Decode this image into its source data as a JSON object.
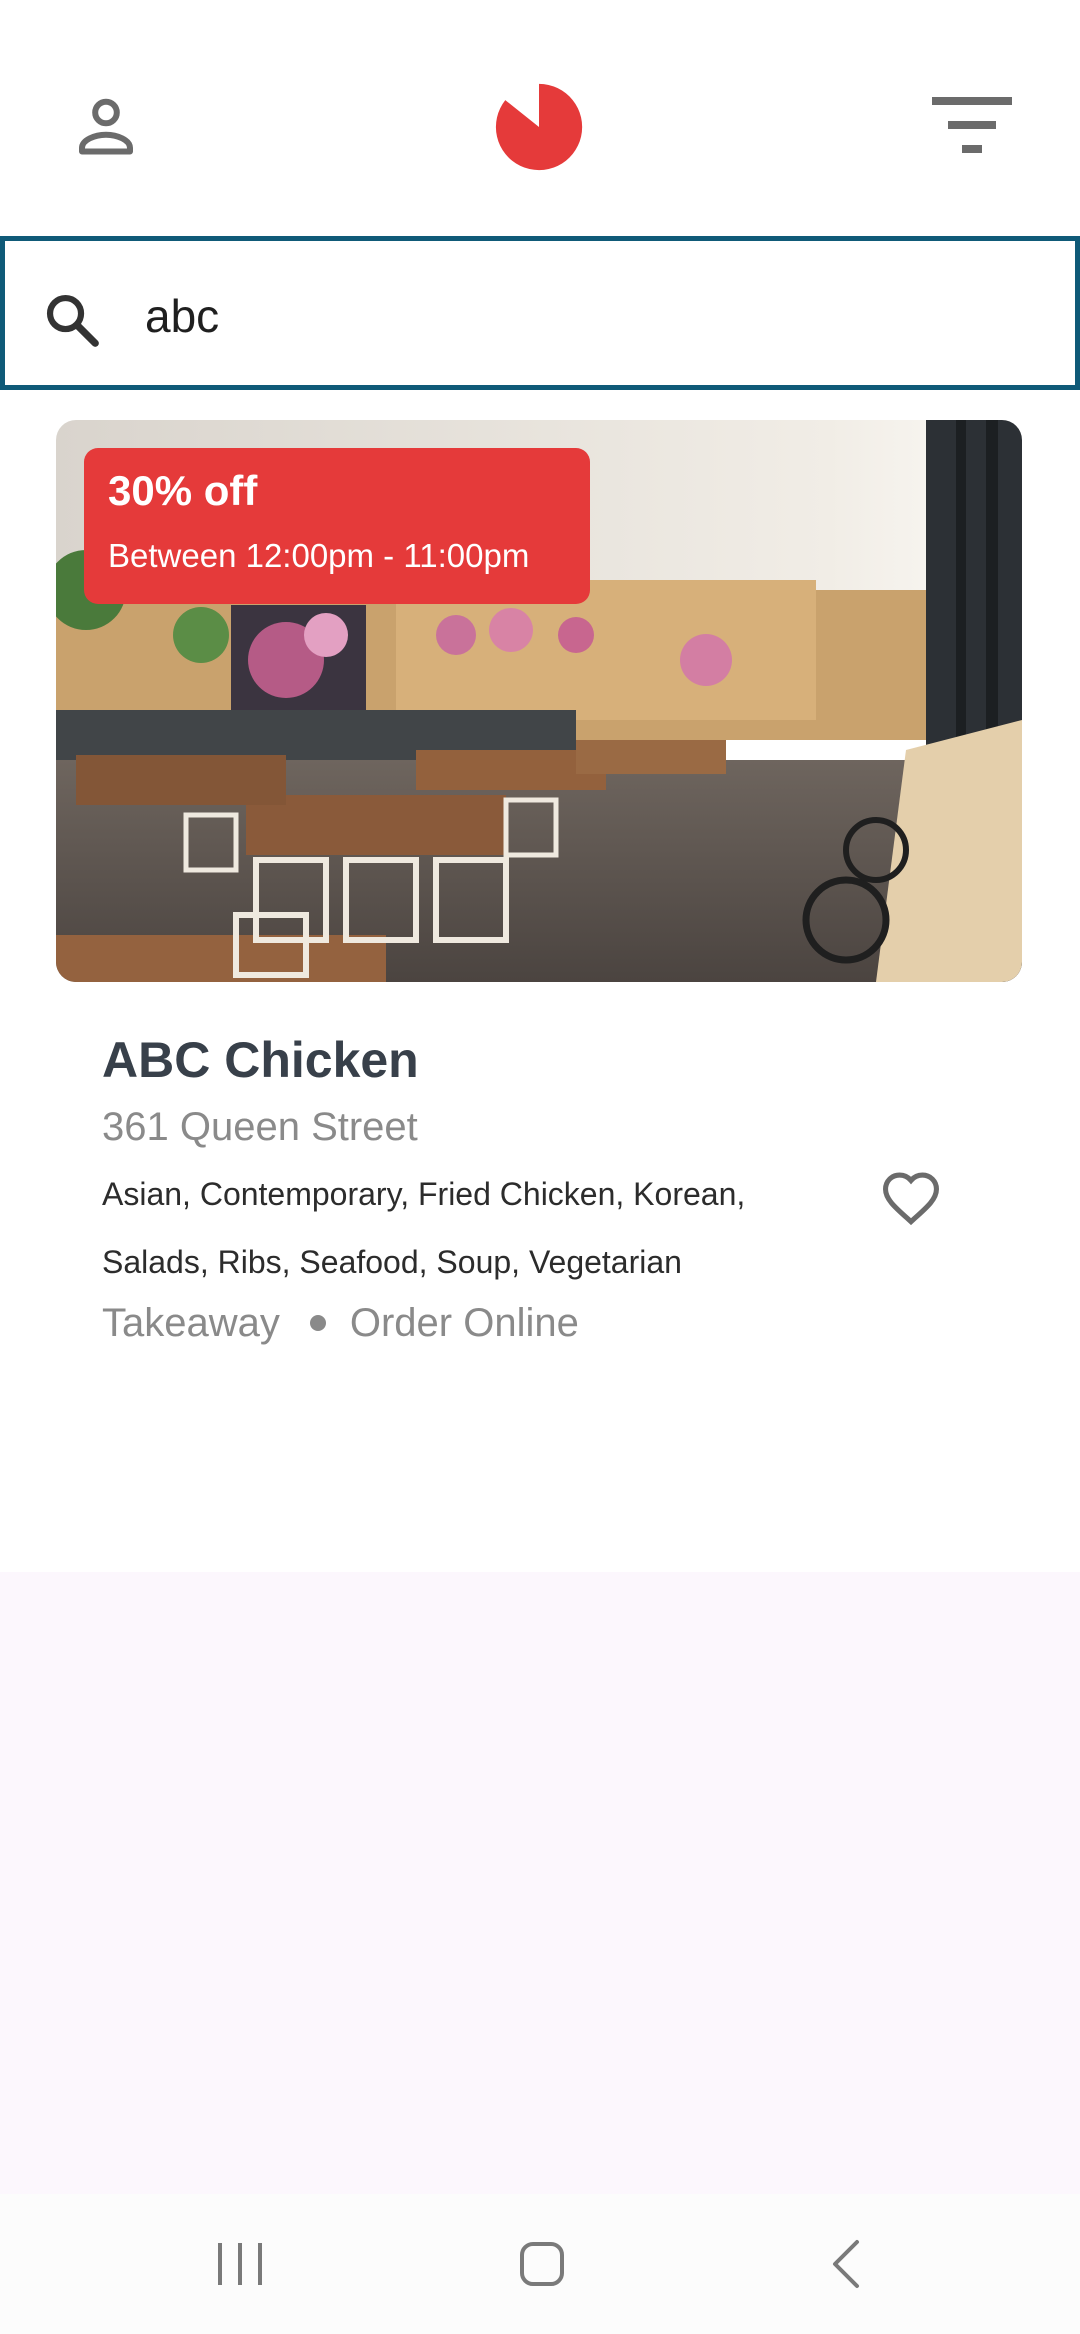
{
  "header": {
    "profile_icon": "person-outline-icon",
    "logo_icon": "red-pie-logo",
    "filter_icon": "filter-list-icon"
  },
  "search": {
    "icon": "search-icon",
    "value": "abc"
  },
  "restaurant": {
    "name": "ABC Chicken",
    "address": "361 Queen Street",
    "cuisines": "Asian, Contemporary, Fried Chicken, Korean, Salads, Ribs, Seafood, Soup, Vegetarian",
    "services": [
      "Takeaway",
      "Order Online"
    ],
    "favorite_icon": "heart-outline-icon",
    "promo": {
      "title": "30% off",
      "time": "Between 12:00pm - 11:00pm"
    }
  },
  "system_nav": {
    "recents_icon": "recent-apps-icon",
    "home_icon": "home-icon",
    "back_icon": "back-icon"
  },
  "colors": {
    "brand_red": "#e53a3a",
    "search_border": "#0f5a78",
    "name_text": "#38404a",
    "muted_text": "#8a8a8a",
    "empty_background": "#fcf7fd"
  }
}
